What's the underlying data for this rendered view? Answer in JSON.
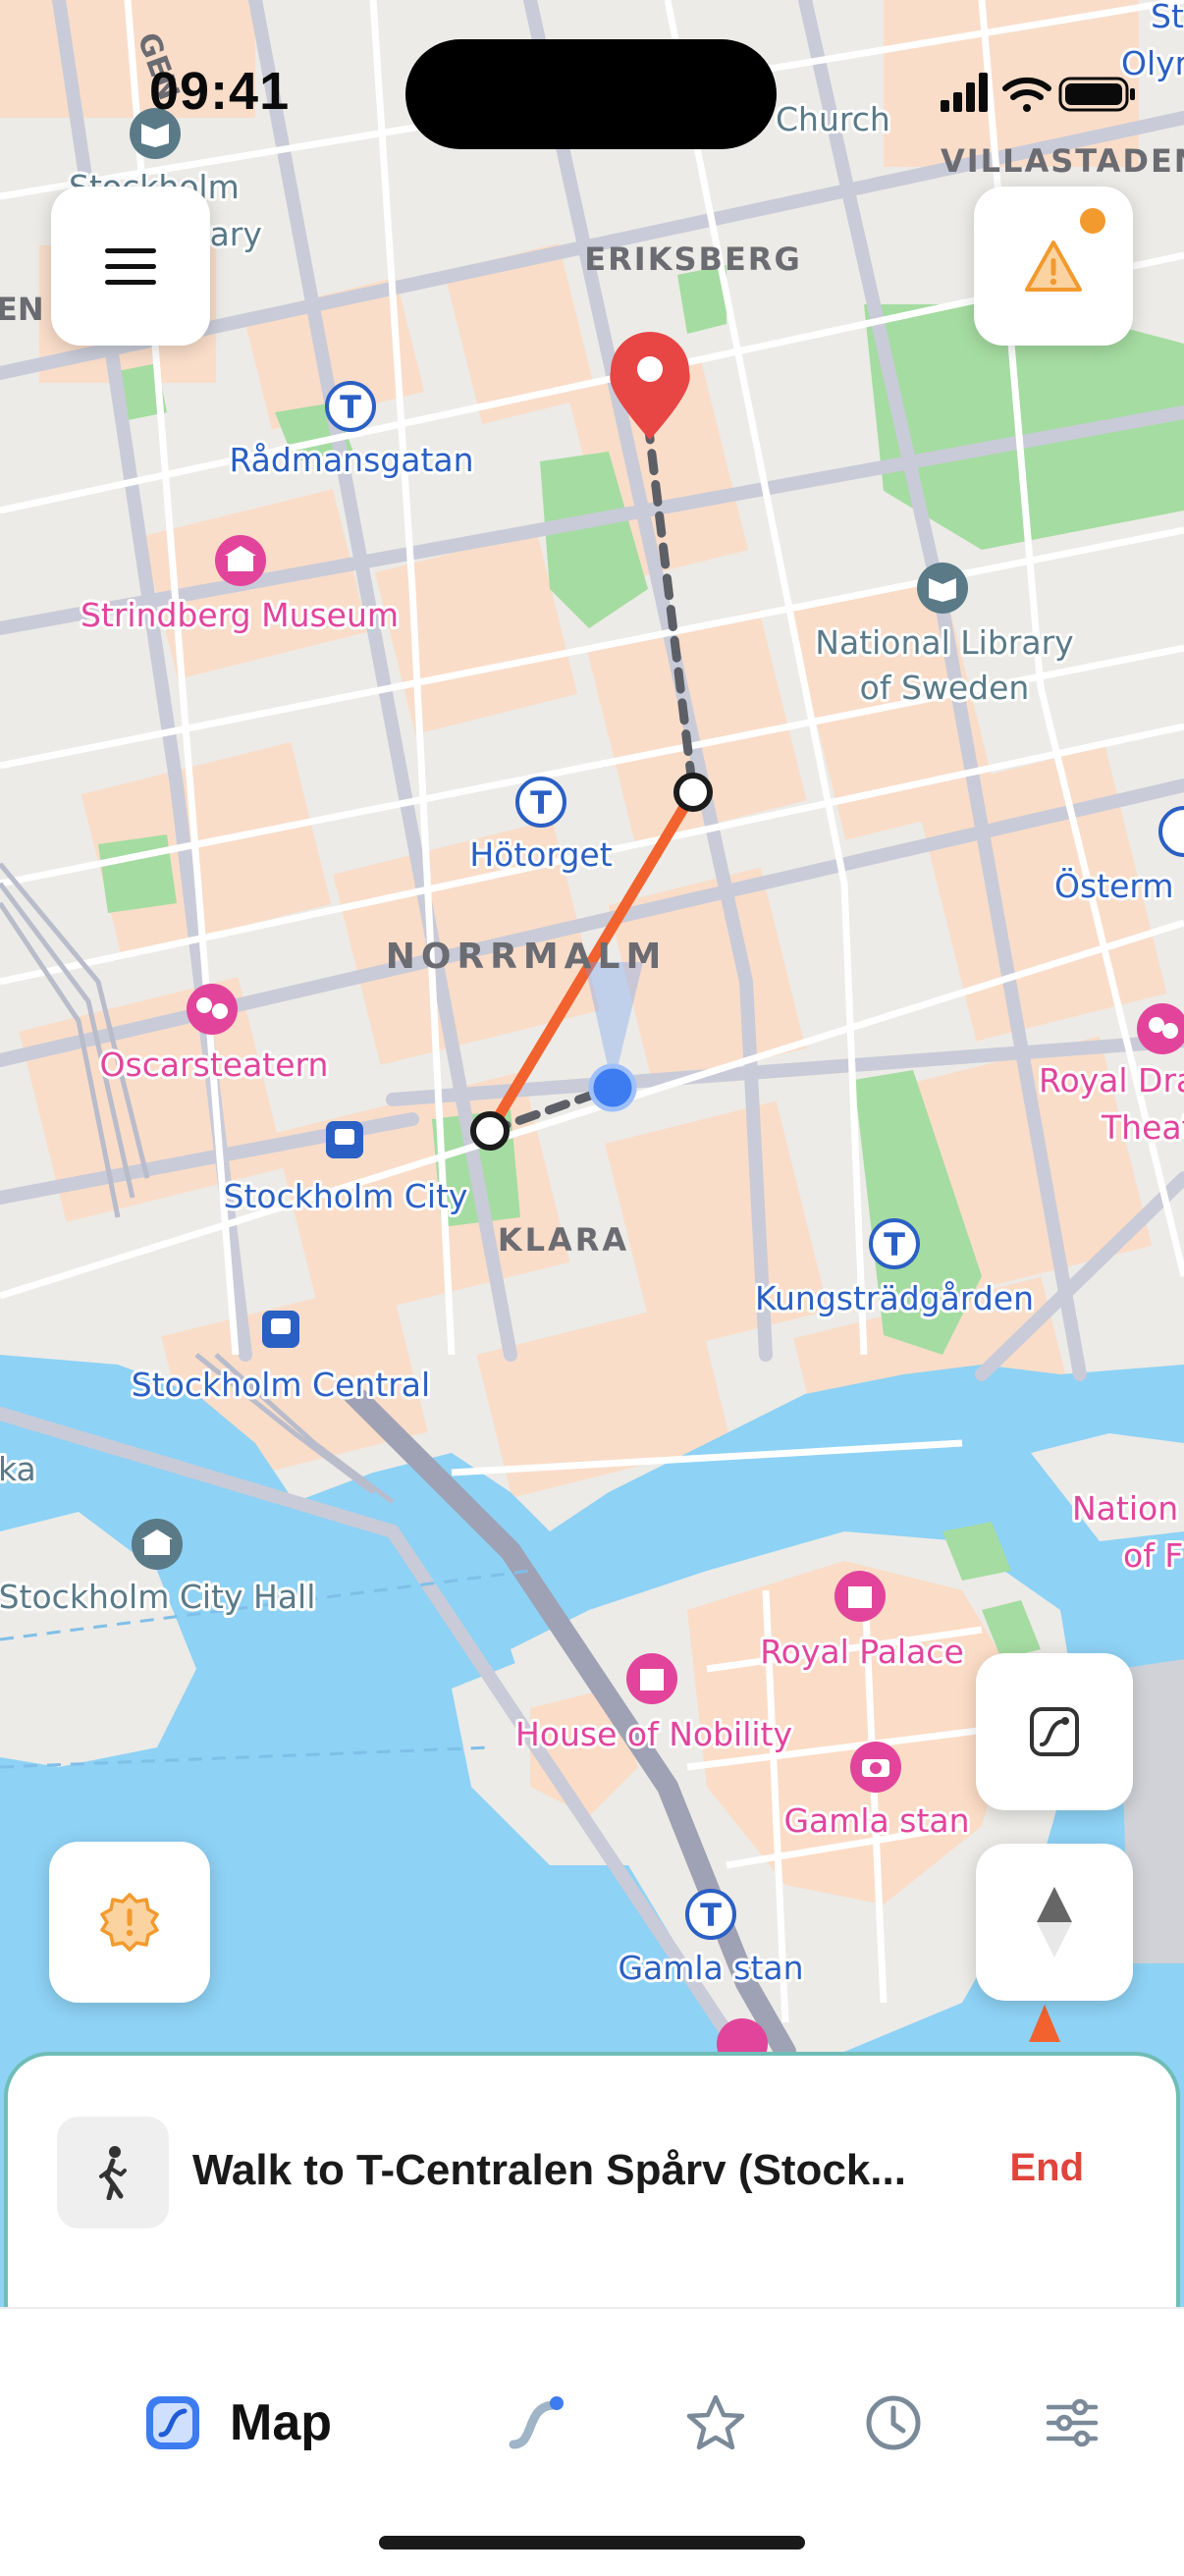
{
  "status_bar": {
    "time": "09:41"
  },
  "map": {
    "district_labels": {
      "eriksberg": "ERIKSBERG",
      "villastaden": "VILLASTADEN",
      "norrmalm": "NORRMALM",
      "klara": "KLARA"
    },
    "places": {
      "radmansgatan": "Rådmansgatan",
      "strindberg": "Strindberg Museum",
      "national_library_1": "National Library",
      "national_library_2": "of Sweden",
      "hotorget": "Hötorget",
      "ostermalm": "Österm",
      "oscarsteatern": "Oscarsteatern",
      "stockholm_city": "Stockholm City",
      "royal_drama_1": "Royal Dra",
      "royal_drama_2": "Theat",
      "kungstradgarden": "Kungsträdgården",
      "stockholm_central": "Stockholm Central",
      "ka": "ka",
      "stockholm_city_hall": "Stockholm City Hall",
      "nation_1": "Nation",
      "nation_2": "of F",
      "royal_palace": "Royal Palace",
      "house_of_nobility": "House of Nobility",
      "gamla_stan_poi": "Gamla stan",
      "gamla_stan_station": "Gamla stan",
      "church": "Church",
      "stockholm_lib_1": "Stockholm",
      "stockholm_lib_2": "rary",
      "en": "EN",
      "st": "St",
      "olym": "Olym",
      "gen": "GEN"
    }
  },
  "route_card": {
    "title": "Walk to T-Centralen Spårv (Stock...",
    "end_label": "End"
  },
  "tab_bar": {
    "map_label": "Map"
  },
  "icons": {
    "menu": "menu-icon",
    "alert": "warning-icon",
    "route": "route-icon",
    "compass": "compass-icon",
    "report": "report-icon",
    "walk": "walk-icon",
    "favorites": "star-icon",
    "history": "clock-icon",
    "settings": "sliders-icon"
  },
  "colors": {
    "route_orange": "#f2622e",
    "walk_dash": "#5d5f66",
    "destination_pin": "#e84545",
    "user_location": "#3d7cf0",
    "water": "#8dd1f4",
    "park": "#8ed48e",
    "poi_pink": "#e2449c",
    "transit_blue": "#2a5fc4",
    "accent_orange": "#f29a2e",
    "card_border": "#6fbdb5"
  }
}
